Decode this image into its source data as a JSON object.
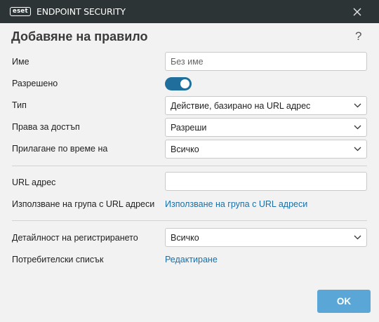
{
  "window": {
    "logo_text": "eset",
    "product_name": "ENDPOINT SECURITY"
  },
  "dialog": {
    "title": "Добавяне на правило",
    "help": "?"
  },
  "form": {
    "name": {
      "label": "Име",
      "value": "",
      "placeholder": "Без име"
    },
    "enabled": {
      "label": "Разрешено",
      "value": true
    },
    "type": {
      "label": "Тип",
      "value": "Действие, базирано на URL адрес"
    },
    "access": {
      "label": "Права за достъп",
      "value": "Разреши"
    },
    "apply_during": {
      "label": "Прилагане по време на",
      "value": "Всичко"
    },
    "url": {
      "label": "URL адрес",
      "value": "",
      "placeholder": ""
    },
    "url_group": {
      "label": "Използване на група с URL адреси",
      "link": "Използване на група с URL адреси"
    },
    "log_verbosity": {
      "label": "Детайлност на регистрирането",
      "value": "Всичко"
    },
    "user_list": {
      "label": "Потребителски списък",
      "link": "Редактиране"
    }
  },
  "buttons": {
    "ok": "OK"
  },
  "colors": {
    "titlebar": "#2d3436",
    "accent": "#1f6e9c",
    "link": "#1a6fa8",
    "ok_button": "#5aa6d6"
  }
}
